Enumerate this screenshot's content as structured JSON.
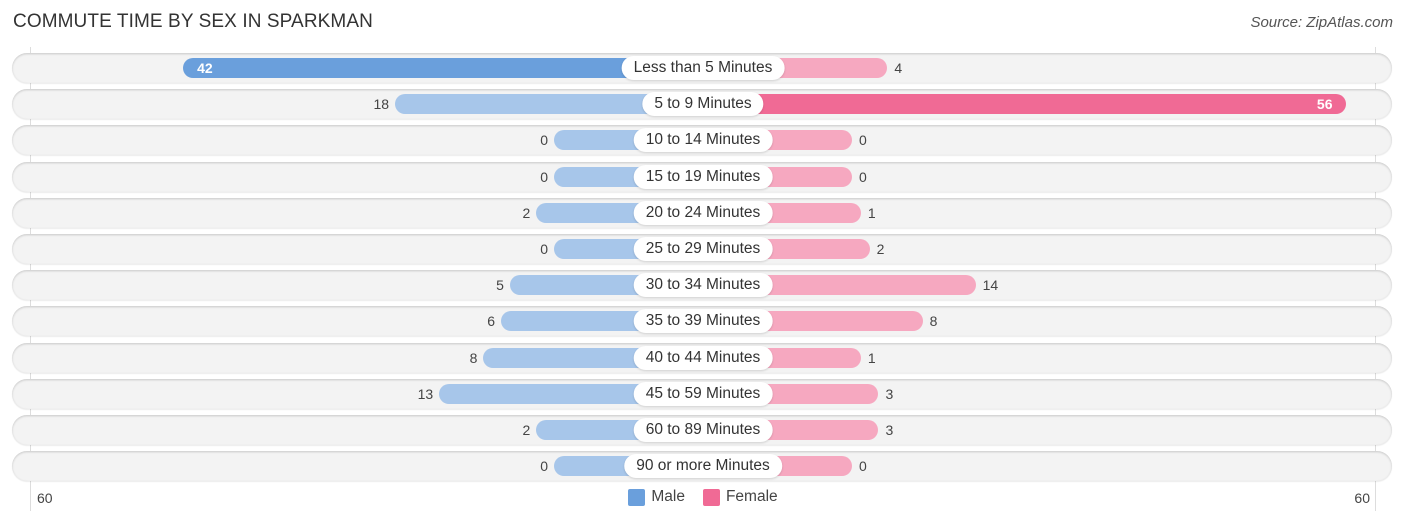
{
  "header": {
    "title": "COMMUTE TIME BY SEX IN SPARKMAN",
    "source": "Source: ZipAtlas.com"
  },
  "colors": {
    "male": "#a7c6ea",
    "male_strong": "#6a9fdc",
    "female": "#f6a8c0",
    "female_strong": "#f06a95"
  },
  "chart_data": {
    "type": "bar",
    "orientation": "diverging-horizontal",
    "title": "COMMUTE TIME BY SEX IN SPARKMAN",
    "categories": [
      "Less than 5 Minutes",
      "5 to 9 Minutes",
      "10 to 14 Minutes",
      "15 to 19 Minutes",
      "20 to 24 Minutes",
      "25 to 29 Minutes",
      "30 to 34 Minutes",
      "35 to 39 Minutes",
      "40 to 44 Minutes",
      "45 to 59 Minutes",
      "60 to 89 Minutes",
      "90 or more Minutes"
    ],
    "series": [
      {
        "name": "Male",
        "side": "left",
        "values": [
          42,
          18,
          0,
          0,
          2,
          0,
          5,
          6,
          8,
          13,
          2,
          0
        ]
      },
      {
        "name": "Female",
        "side": "right",
        "values": [
          4,
          56,
          0,
          0,
          1,
          2,
          14,
          8,
          1,
          3,
          3,
          0
        ]
      }
    ],
    "axis": {
      "left_label": "60",
      "right_label": "60",
      "range": [
        0,
        60
      ]
    },
    "legend": {
      "position": "bottom-center",
      "entries": [
        "Male",
        "Female"
      ]
    },
    "grid": false
  }
}
